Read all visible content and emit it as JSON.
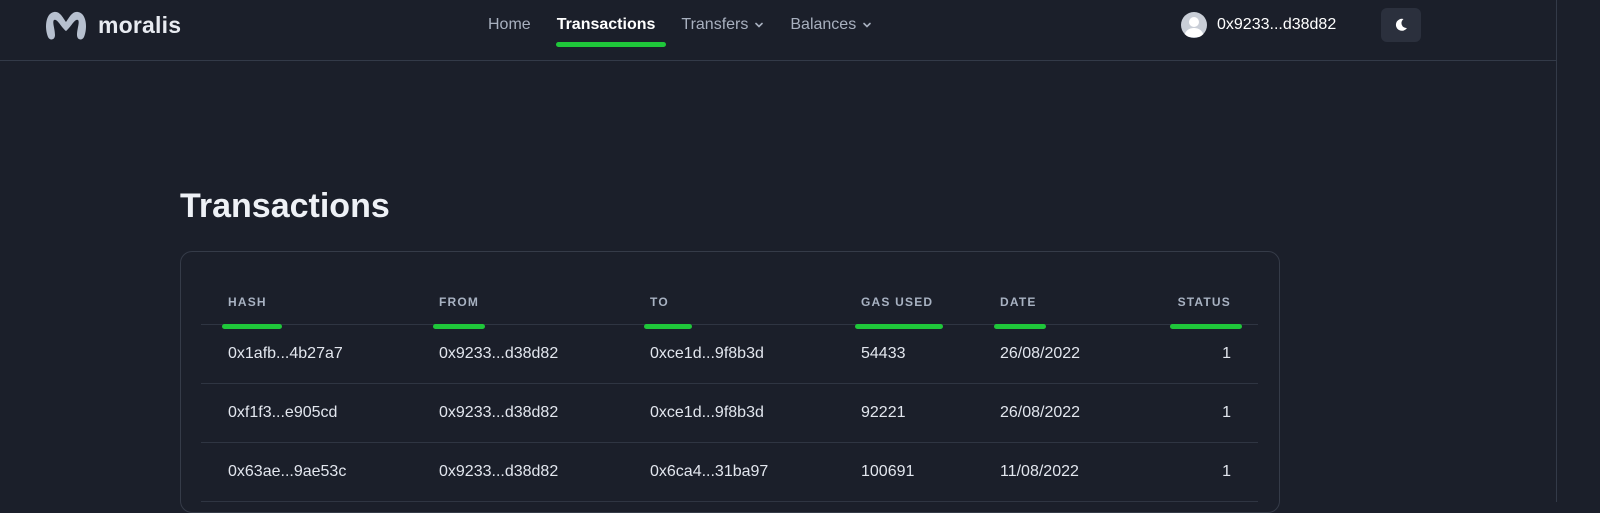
{
  "brand": {
    "name": "moralis"
  },
  "nav": {
    "links": [
      {
        "label": "Home"
      },
      {
        "label": "Transactions"
      },
      {
        "label": "Transfers"
      },
      {
        "label": "Balances"
      }
    ]
  },
  "account": {
    "address": "0x9233...d38d82"
  },
  "theme_toggle": {
    "icon": "moon-icon"
  },
  "page": {
    "title": "Transactions"
  },
  "table": {
    "columns": [
      "HASH",
      "FROM",
      "TO",
      "GAS USED",
      "DATE",
      "STATUS"
    ],
    "rows": [
      [
        "0x1afb...4b27a7",
        "0x9233...d38d82",
        "0xce1d...9f8b3d",
        "54433",
        "26/08/2022",
        "1"
      ],
      [
        "0xf1f3...e905cd",
        "0x9233...d38d82",
        "0xce1d...9f8b3d",
        "92221",
        "26/08/2022",
        "1"
      ],
      [
        "0x63ae...9ae53c",
        "0x9233...d38d82",
        "0x6ca4...31ba97",
        "100691",
        "11/08/2022",
        "1"
      ]
    ]
  },
  "colors": {
    "background": "#1b1f2a",
    "highlight": "#1fc73a",
    "muted_text": "#a8b2c2"
  }
}
